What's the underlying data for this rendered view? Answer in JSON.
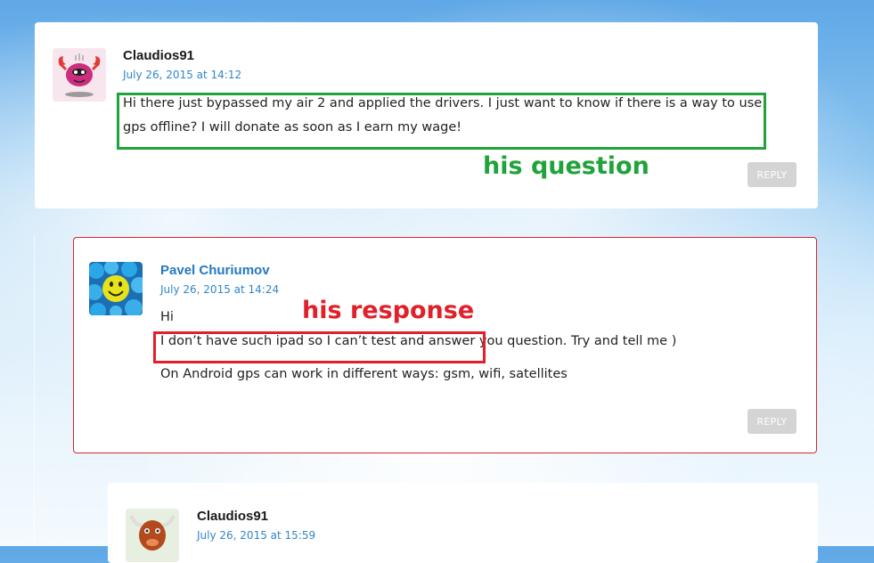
{
  "comments": [
    {
      "author": "Claudios91",
      "date": "July 26, 2015 at 14:12",
      "paragraphs": [
        "Hi there just bypassed my air 2 and applied the drivers. I just want to know if there is a way to use gps offline? I will donate as soon as I earn my wage!"
      ],
      "reply_label": "REPLY",
      "avatar_icon": "crab-monster-avatar-icon"
    },
    {
      "author": "Pavel Churiumov",
      "date": "July 26, 2015 at 14:24",
      "paragraphs": [
        "Hi",
        "I don’t have such ipad so I can’t test and answer you question. Try and tell me )",
        "On Android gps can work in different ways: gsm, wifi, satellites"
      ],
      "reply_label": "REPLY",
      "avatar_icon": "smiley-balls-avatar-icon"
    },
    {
      "author": "Claudios91",
      "date": "July 26, 2015 at 15:59",
      "avatar_icon": "bull-avatar-icon"
    }
  ],
  "annotations": {
    "question_label": "his question",
    "response_label": "his response",
    "question_color": "#1fa33a",
    "response_color": "#e0202a"
  }
}
